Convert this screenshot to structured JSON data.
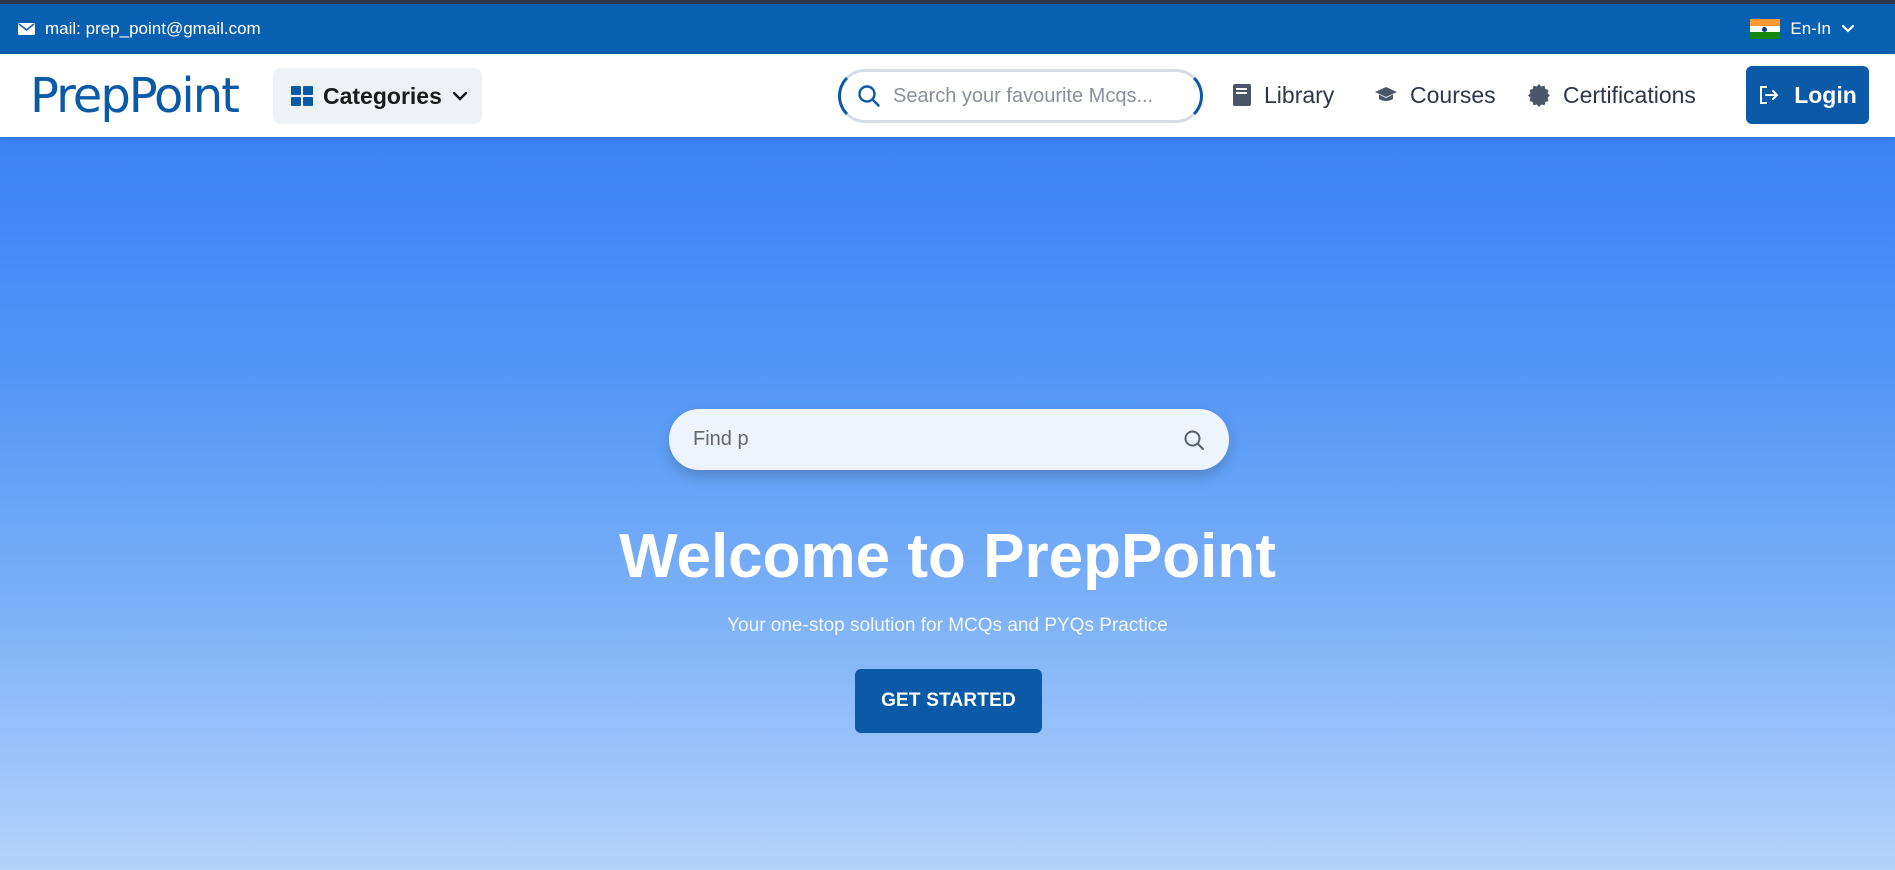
{
  "topbar": {
    "email": "mail: prep_point@gmail.com",
    "language": "En-In",
    "mail_icon": "envelope-icon",
    "flag_icon": "india-flag-icon"
  },
  "navbar": {
    "logo_text": "PrepPoint",
    "categories_label": "Categories",
    "search_placeholder": "Search your favourite Mcqs...",
    "links": [
      {
        "label": "Library",
        "icon": "book-icon"
      },
      {
        "label": "Courses",
        "icon": "graduation-cap-icon"
      },
      {
        "label": "Certifications",
        "icon": "badge-icon"
      }
    ],
    "login_label": "Login"
  },
  "hero": {
    "search_value": "Find p",
    "title": "Welcome to PrepPoint",
    "subtitle": "Your one-stop solution for MCQs and PYQs Practice",
    "cta_label": "GET STARTED"
  },
  "colors": {
    "brand": "#0a5aa8",
    "topbar": "#0a60b0",
    "hero_top": "#3b82f6",
    "hero_bottom": "#b4d3fb"
  }
}
